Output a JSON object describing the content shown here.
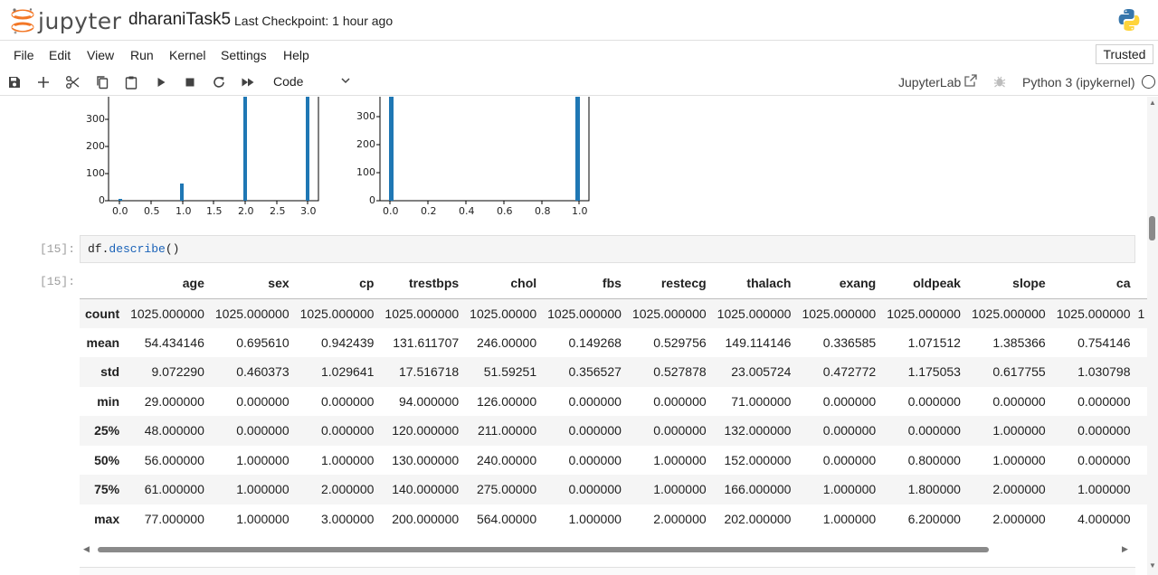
{
  "header": {
    "logo_text": "jupyter",
    "notebook_title": "dharaniTask5",
    "checkpoint": "Last Checkpoint: 1 hour ago"
  },
  "menu": {
    "items": [
      "File",
      "Edit",
      "View",
      "Run",
      "Kernel",
      "Settings",
      "Help"
    ],
    "trusted": "Trusted"
  },
  "toolbar": {
    "buttons": [
      "save-icon",
      "add-cell-icon",
      "cut-icon",
      "copy-icon",
      "paste-icon",
      "run-icon",
      "stop-icon",
      "restart-icon",
      "fast-forward-icon"
    ],
    "cell_type": "Code",
    "jupyterlab": "JupyterLab",
    "kernel": "Python 3 (ipykernel)"
  },
  "plots": {
    "left": {
      "y_ticks": [
        "300",
        "200",
        "100",
        "0"
      ],
      "x_ticks": [
        "0.0",
        "0.5",
        "1.0",
        "1.5",
        "2.0",
        "2.5",
        "3.0"
      ],
      "bar_color": "#1f77b4"
    },
    "right": {
      "y_ticks": [
        "300",
        "200",
        "100",
        "0"
      ],
      "x_ticks": [
        "0.0",
        "0.2",
        "0.4",
        "0.6",
        "0.8",
        "1.0"
      ],
      "bar_color": "#1f77b4"
    }
  },
  "cells": {
    "input_prompt": "[15]:",
    "output_prompt": "[15]:",
    "code_obj": "df.",
    "code_method": "describe",
    "code_rest": "()"
  },
  "describe_table": {
    "columns": [
      "age",
      "sex",
      "cp",
      "trestbps",
      "chol",
      "fbs",
      "restecg",
      "thalach",
      "exang",
      "oldpeak",
      "slope",
      "ca"
    ],
    "rows": [
      {
        "label": "count",
        "values": [
          "1025.000000",
          "1025.000000",
          "1025.000000",
          "1025.000000",
          "1025.00000",
          "1025.000000",
          "1025.000000",
          "1025.000000",
          "1025.000000",
          "1025.000000",
          "1025.000000",
          "1025.000000"
        ]
      },
      {
        "label": "mean",
        "values": [
          "54.434146",
          "0.695610",
          "0.942439",
          "131.611707",
          "246.00000",
          "0.149268",
          "0.529756",
          "149.114146",
          "0.336585",
          "1.071512",
          "1.385366",
          "0.754146"
        ]
      },
      {
        "label": "std",
        "values": [
          "9.072290",
          "0.460373",
          "1.029641",
          "17.516718",
          "51.59251",
          "0.356527",
          "0.527878",
          "23.005724",
          "0.472772",
          "1.175053",
          "0.617755",
          "1.030798"
        ]
      },
      {
        "label": "min",
        "values": [
          "29.000000",
          "0.000000",
          "0.000000",
          "94.000000",
          "126.00000",
          "0.000000",
          "0.000000",
          "71.000000",
          "0.000000",
          "0.000000",
          "0.000000",
          "0.000000"
        ]
      },
      {
        "label": "25%",
        "values": [
          "48.000000",
          "0.000000",
          "0.000000",
          "120.000000",
          "211.00000",
          "0.000000",
          "0.000000",
          "132.000000",
          "0.000000",
          "0.000000",
          "1.000000",
          "0.000000"
        ]
      },
      {
        "label": "50%",
        "values": [
          "56.000000",
          "1.000000",
          "1.000000",
          "130.000000",
          "240.00000",
          "0.000000",
          "1.000000",
          "152.000000",
          "0.000000",
          "0.800000",
          "1.000000",
          "0.000000"
        ]
      },
      {
        "label": "75%",
        "values": [
          "61.000000",
          "1.000000",
          "2.000000",
          "140.000000",
          "275.00000",
          "0.000000",
          "1.000000",
          "166.000000",
          "1.000000",
          "1.800000",
          "2.000000",
          "1.000000"
        ]
      },
      {
        "label": "max",
        "values": [
          "77.000000",
          "1.000000",
          "3.000000",
          "200.000000",
          "564.00000",
          "1.000000",
          "2.000000",
          "202.000000",
          "1.000000",
          "6.200000",
          "2.000000",
          "4.000000"
        ]
      }
    ],
    "overflow_glyph": "1"
  }
}
